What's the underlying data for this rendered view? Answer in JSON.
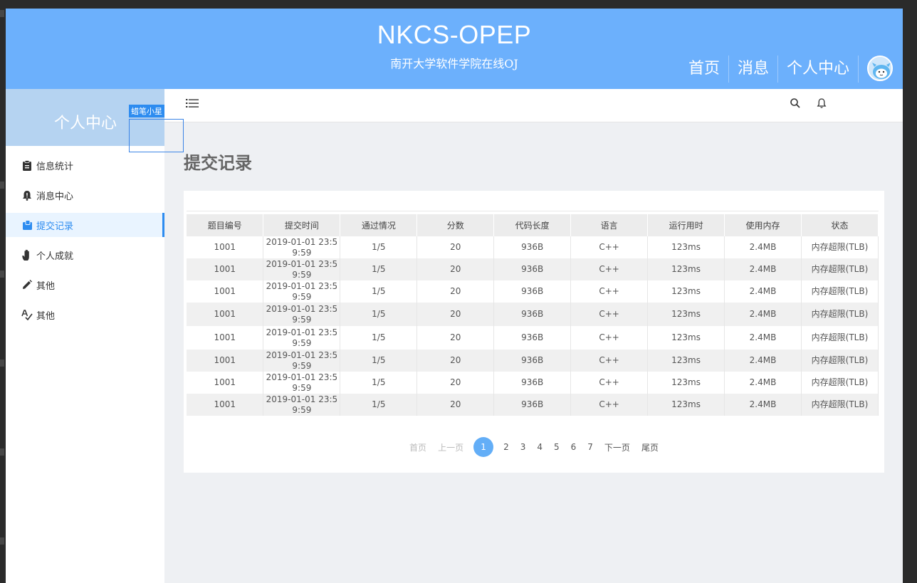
{
  "header": {
    "title": "NKCS-OPEP",
    "subtitle": "南开大学软件学院在线OJ",
    "nav": [
      {
        "label": "首页"
      },
      {
        "label": "消息"
      },
      {
        "label": "个人中心"
      }
    ]
  },
  "sidebar": {
    "title": "个人中心",
    "tag": "蜡笔小星",
    "items": [
      {
        "label": "信息统计",
        "icon": "clipboard-icon"
      },
      {
        "label": "消息中心",
        "icon": "bell-alert-icon"
      },
      {
        "label": "提交记录",
        "icon": "submit-icon",
        "active": true
      },
      {
        "label": "个人成就",
        "icon": "hand-icon"
      },
      {
        "label": "其他",
        "icon": "pencil-icon"
      },
      {
        "label": "其他",
        "icon": "spellcheck-icon"
      }
    ]
  },
  "main": {
    "title": "提交记录",
    "columns": [
      "题目编号",
      "提交时间",
      "通过情况",
      "分数",
      "代码长度",
      "语言",
      "运行用时",
      "使用内存",
      "状态"
    ],
    "rows": [
      [
        "1001",
        "2019-01-01 23:59:59",
        "1/5",
        "20",
        "936B",
        "C++",
        "123ms",
        "2.4MB",
        "内存超限(TLB)"
      ],
      [
        "1001",
        "2019-01-01 23:59:59",
        "1/5",
        "20",
        "936B",
        "C++",
        "123ms",
        "2.4MB",
        "内存超限(TLB)"
      ],
      [
        "1001",
        "2019-01-01 23:59:59",
        "1/5",
        "20",
        "936B",
        "C++",
        "123ms",
        "2.4MB",
        "内存超限(TLB)"
      ],
      [
        "1001",
        "2019-01-01 23:59:59",
        "1/5",
        "20",
        "936B",
        "C++",
        "123ms",
        "2.4MB",
        "内存超限(TLB)"
      ],
      [
        "1001",
        "2019-01-01 23:59:59",
        "1/5",
        "20",
        "936B",
        "C++",
        "123ms",
        "2.4MB",
        "内存超限(TLB)"
      ],
      [
        "1001",
        "2019-01-01 23:59:59",
        "1/5",
        "20",
        "936B",
        "C++",
        "123ms",
        "2.4MB",
        "内存超限(TLB)"
      ],
      [
        "1001",
        "2019-01-01 23:59:59",
        "1/5",
        "20",
        "936B",
        "C++",
        "123ms",
        "2.4MB",
        "内存超限(TLB)"
      ],
      [
        "1001",
        "2019-01-01 23:59:59",
        "1/5",
        "20",
        "936B",
        "C++",
        "123ms",
        "2.4MB",
        "内存超限(TLB)"
      ]
    ]
  },
  "pager": {
    "first": "首页",
    "prev": "上一页",
    "pages": [
      "1",
      "2",
      "3",
      "4",
      "5",
      "6",
      "7"
    ],
    "current": "1",
    "next": "下一页",
    "last": "尾页"
  },
  "colors": {
    "header_bg": "#6cb0fc",
    "sidebar_head_bg": "#b5d3f1",
    "accent": "#2d8cf0"
  }
}
